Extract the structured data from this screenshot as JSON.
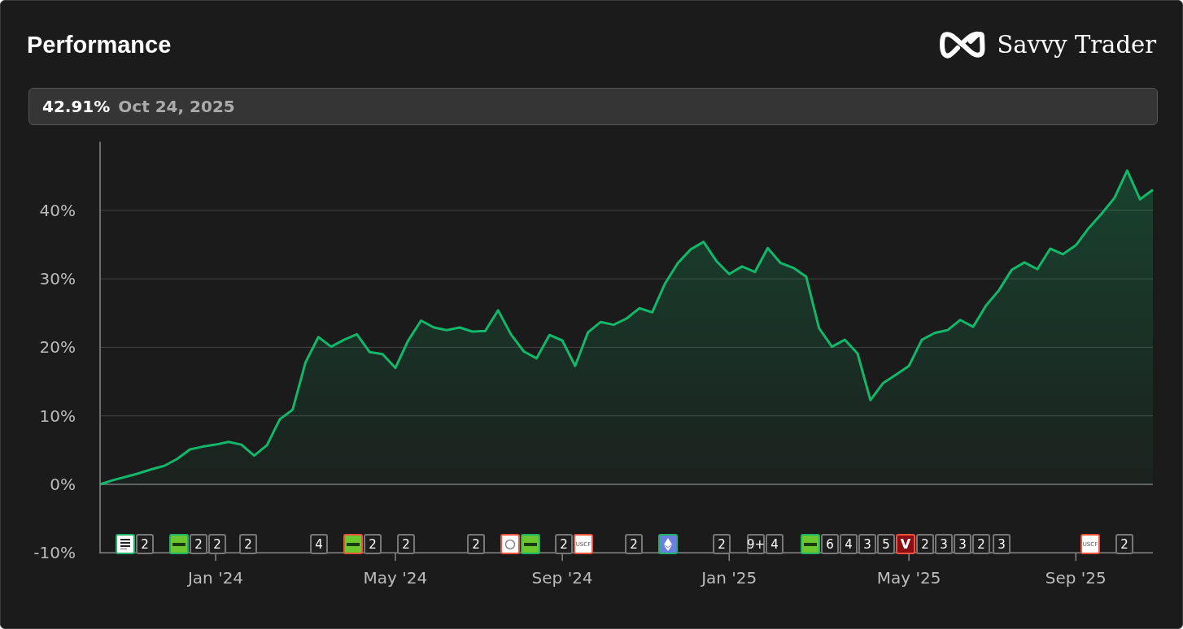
{
  "header": {
    "title": "Performance",
    "brand": "Savvy Trader"
  },
  "summary": {
    "value": "42.91%",
    "date": "Oct 24, 2025"
  },
  "chart_data": {
    "type": "area",
    "grid": true,
    "ylim": [
      -10,
      50
    ],
    "yticks": [
      {
        "value": -10,
        "label": "-10%"
      },
      {
        "value": 0,
        "label": "0%"
      },
      {
        "value": 10,
        "label": "10%"
      },
      {
        "value": 20,
        "label": "20%"
      },
      {
        "value": 30,
        "label": "30%"
      },
      {
        "value": 40,
        "label": "40%"
      }
    ],
    "categories": [
      null,
      null,
      null,
      null,
      null,
      null,
      null,
      null,
      null,
      "Jan '24",
      null,
      null,
      null,
      null,
      null,
      null,
      null,
      null,
      null,
      null,
      null,
      null,
      null,
      "May '24",
      null,
      null,
      null,
      null,
      null,
      null,
      null,
      null,
      null,
      null,
      null,
      null,
      "Sep '24",
      null,
      null,
      null,
      null,
      null,
      null,
      null,
      null,
      null,
      null,
      null,
      null,
      "Jan '25",
      null,
      null,
      null,
      null,
      null,
      null,
      null,
      null,
      null,
      null,
      null,
      null,
      null,
      "May '25",
      null,
      null,
      null,
      null,
      null,
      null,
      null,
      null,
      null,
      null,
      null,
      null,
      "Sep '25",
      null,
      null,
      null,
      null,
      null,
      null
    ],
    "series": [
      {
        "color": "#12b76a",
        "values": [
          0,
          0.6,
          1.1,
          1.6,
          2.2,
          2.7,
          3.7,
          5.1,
          5.5,
          5.8,
          6.2,
          5.8,
          4.2,
          5.7,
          9.5,
          10.9,
          17.8,
          21.5,
          20.1,
          21.1,
          21.9,
          19.3,
          19,
          17,
          21,
          23.9,
          22.9,
          22.5,
          22.9,
          22.3,
          22.4,
          25.4,
          21.9,
          19.4,
          18.4,
          21.8,
          21,
          17.3,
          22.2,
          23.7,
          23.3,
          24.2,
          25.7,
          25.1,
          29.3,
          32.3,
          34.3,
          35.4,
          32.6,
          30.7,
          31.8,
          31,
          34.5,
          32.3,
          31.6,
          30.3,
          22.8,
          20.1,
          21.1,
          19.1,
          12.3,
          14.8,
          16,
          17.3,
          21.1,
          22.1,
          22.5,
          24,
          23,
          26.1,
          28.3,
          31.3,
          32.4,
          31.4,
          34.4,
          33.6,
          34.9,
          37.4,
          39.5,
          41.8,
          45.8,
          41.6,
          43
        ]
      }
    ]
  },
  "events": [
    {
      "items": [
        {
          "kind": "statestreet",
          "color": "#1db46a"
        },
        {
          "kind": "count",
          "label": "2"
        }
      ]
    },
    {
      "items": [
        {
          "kind": "ishares",
          "color": "#1db46a"
        },
        {
          "kind": "count",
          "label": "2"
        },
        {
          "kind": "count",
          "label": "2"
        }
      ]
    },
    {
      "items": [
        {
          "kind": "count",
          "label": "2"
        }
      ]
    },
    {
      "items": [
        {
          "kind": "count",
          "label": "4"
        }
      ]
    },
    {
      "items": [
        {
          "kind": "ishares",
          "color": "#f0523c"
        },
        {
          "kind": "count",
          "label": "2"
        }
      ]
    },
    {
      "items": [
        {
          "kind": "count",
          "label": "2"
        }
      ]
    },
    {
      "items": [
        {
          "kind": "count",
          "label": "2"
        }
      ]
    },
    {
      "items": [
        {
          "kind": "circle",
          "color": "#f0523c"
        },
        {
          "kind": "ishares",
          "color": "#1db46a"
        }
      ]
    },
    {
      "items": [
        {
          "kind": "count",
          "label": "2"
        },
        {
          "kind": "uscf",
          "label": "USCF",
          "color": "#f0523c"
        }
      ]
    },
    {
      "items": [
        {
          "kind": "count",
          "label": "2"
        }
      ]
    },
    {
      "items": [
        {
          "kind": "eth",
          "color": "#1db46a"
        }
      ]
    },
    {
      "items": [
        {
          "kind": "count",
          "label": "2"
        }
      ]
    },
    {
      "items": [
        {
          "kind": "count",
          "label": "9+"
        },
        {
          "kind": "count",
          "label": "4"
        }
      ]
    },
    {
      "items": [
        {
          "kind": "ishares",
          "color": "#1db46a"
        },
        {
          "kind": "count",
          "label": "6"
        },
        {
          "kind": "count",
          "label": "4"
        },
        {
          "kind": "count",
          "label": "3"
        },
        {
          "kind": "count",
          "label": "5"
        },
        {
          "kind": "letter",
          "label": "V",
          "color": "#f0523c"
        },
        {
          "kind": "count",
          "label": "2"
        },
        {
          "kind": "count",
          "label": "3"
        },
        {
          "kind": "count",
          "label": "3"
        },
        {
          "kind": "count",
          "label": "2"
        }
      ]
    },
    {
      "items": [
        {
          "kind": "count",
          "label": "3"
        }
      ]
    },
    {
      "items": [
        {
          "kind": "uscf",
          "label": "USCF",
          "color": "#f0523c"
        }
      ]
    },
    {
      "items": [
        {
          "kind": "count",
          "label": "2"
        }
      ]
    }
  ]
}
